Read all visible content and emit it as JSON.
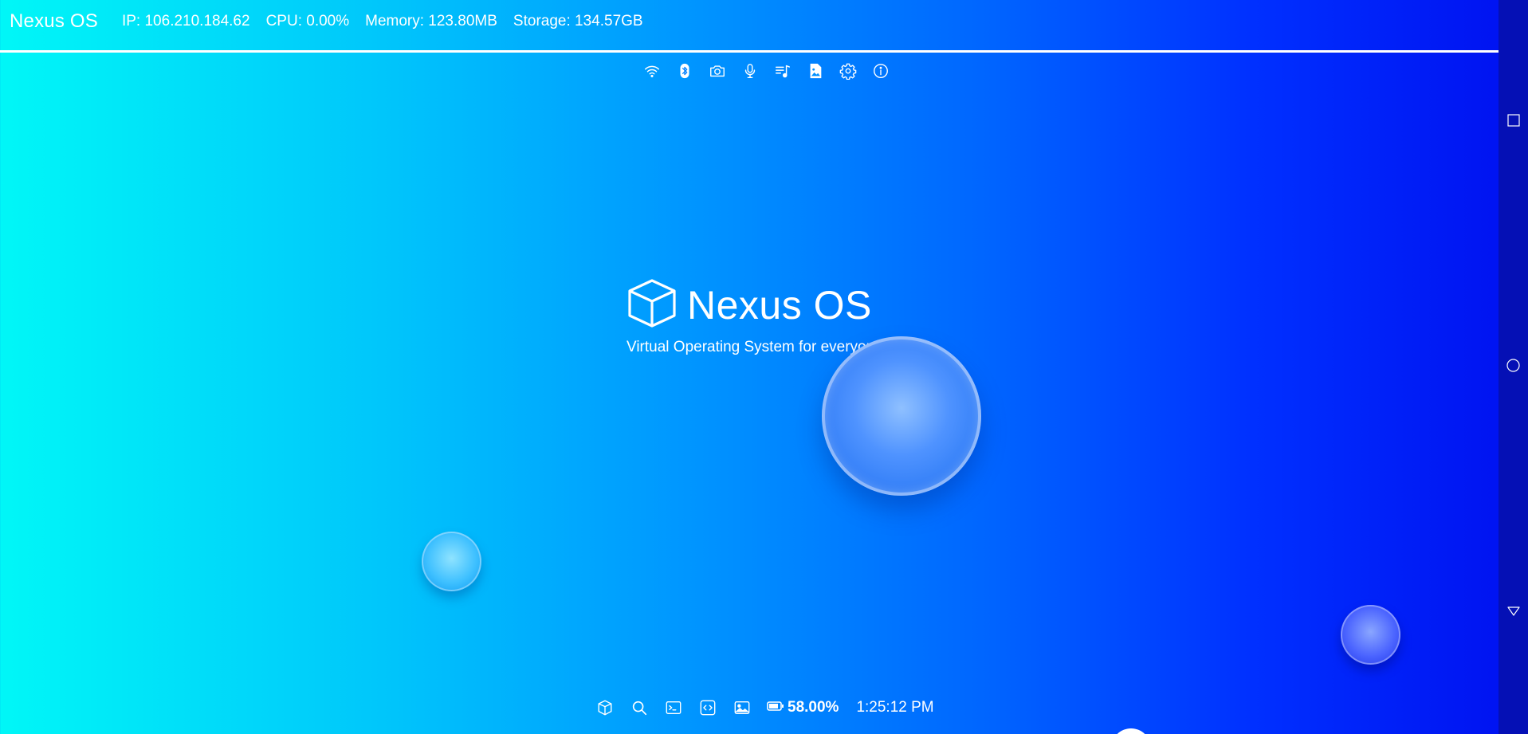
{
  "topbar": {
    "brand": "Nexus OS",
    "ip": "IP: 106.210.184.62",
    "cpu": "CPU: 0.00%",
    "memory": "Memory: 123.80MB",
    "storage": "Storage: 134.57GB"
  },
  "quick_icons": [
    "wifi-icon",
    "bluetooth-icon",
    "camera-icon",
    "microphone-icon",
    "music-playlist-icon",
    "image-file-icon",
    "gear-icon",
    "info-icon"
  ],
  "hero": {
    "title": "Nexus OS",
    "subtitle": "Virtual Operating System for everyone"
  },
  "taskbar": {
    "icons": [
      "cube-icon",
      "search-icon",
      "terminal-icon",
      "code-icon",
      "image-icon"
    ],
    "battery": "58.00%",
    "time": "1:25:12 PM"
  },
  "navrail": [
    "square-icon",
    "circle-icon",
    "triangle-down-icon"
  ],
  "colors": {
    "gradient_start": "#00f7f7",
    "gradient_end": "#0010f0",
    "navrail": "#0510b5",
    "text": "#ffffff"
  }
}
